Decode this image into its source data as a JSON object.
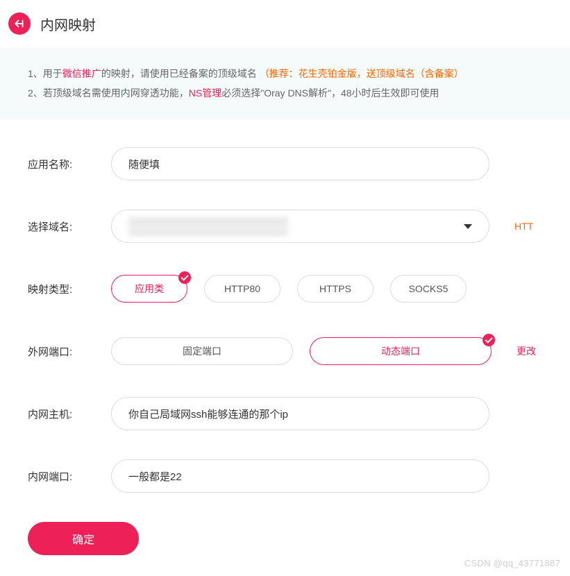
{
  "header": {
    "title": "内网映射"
  },
  "notice": {
    "line1": {
      "prefix": "1、用于",
      "hl1": "微信推广",
      "mid": "的映射，请使用已经备案的顶级域名 ",
      "hl2": "（推荐：花生壳铂金版，送顶级域名（含备案）"
    },
    "line2": {
      "prefix": "2、若顶级域名需使用内网穿透功能，",
      "hl1": "NS管理",
      "suffix": "必须选择\"Oray DNS解析\"，48小时后生效即可使用"
    }
  },
  "form": {
    "appName": {
      "label": "应用名称:",
      "value": "随便填"
    },
    "domain": {
      "label": "选择域名:",
      "side": "HTT"
    },
    "mapType": {
      "label": "映射类型:",
      "options": [
        {
          "label": "应用类",
          "selected": true
        },
        {
          "label": "HTTP80",
          "selected": false
        },
        {
          "label": "HTTPS",
          "selected": false
        },
        {
          "label": "SOCKS5",
          "selected": false
        }
      ]
    },
    "extPort": {
      "label": "外网端口:",
      "options": [
        {
          "label": "固定端口",
          "selected": false
        },
        {
          "label": "动态端口",
          "selected": true
        }
      ],
      "side": "更改"
    },
    "intHost": {
      "label": "内网主机:",
      "value": "你自己局域网ssh能够连通的那个ip"
    },
    "intPort": {
      "label": "内网端口:",
      "value": "一般都是22"
    },
    "submit": "确定"
  },
  "watermark": "CSDN @qq_43771887"
}
